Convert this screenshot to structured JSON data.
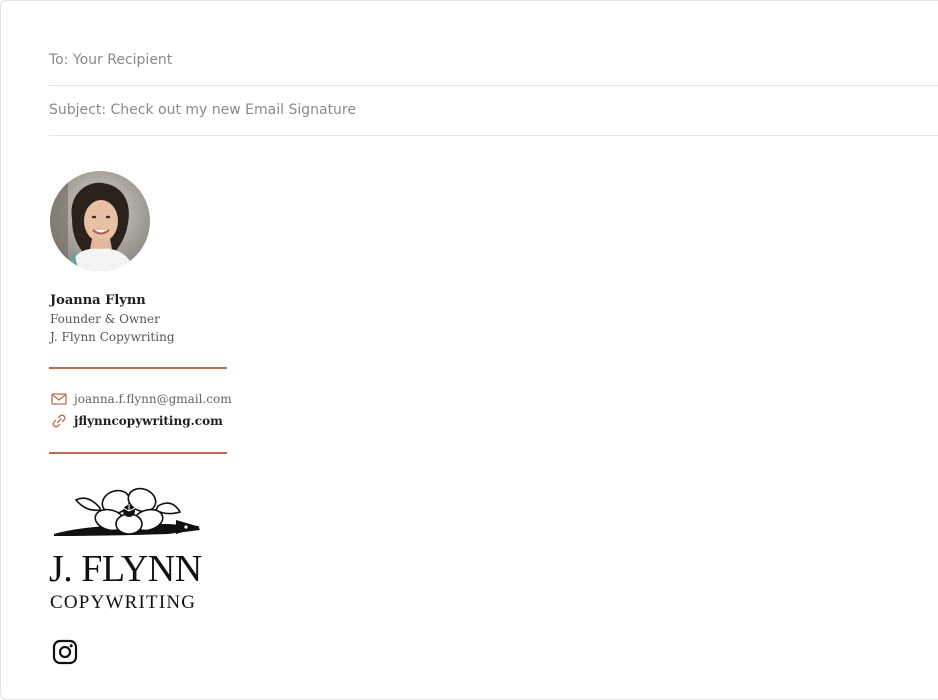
{
  "compose": {
    "to": "To: Your Recipient",
    "subject": "Subject: Check out my new Email Signature"
  },
  "signature": {
    "name": "Joanna Flynn",
    "title": "Founder & Owner",
    "company": "J. Flynn Copywriting",
    "email": "joanna.f.flynn@gmail.com",
    "website": "jflynncopywriting.com",
    "accent_color": "#b5704f",
    "icons": {
      "email": "envelope-icon",
      "website": "link-icon",
      "social": "instagram-icon"
    }
  },
  "logo": {
    "line1": "J. FLYNN",
    "line2": "COPYWRITING"
  }
}
